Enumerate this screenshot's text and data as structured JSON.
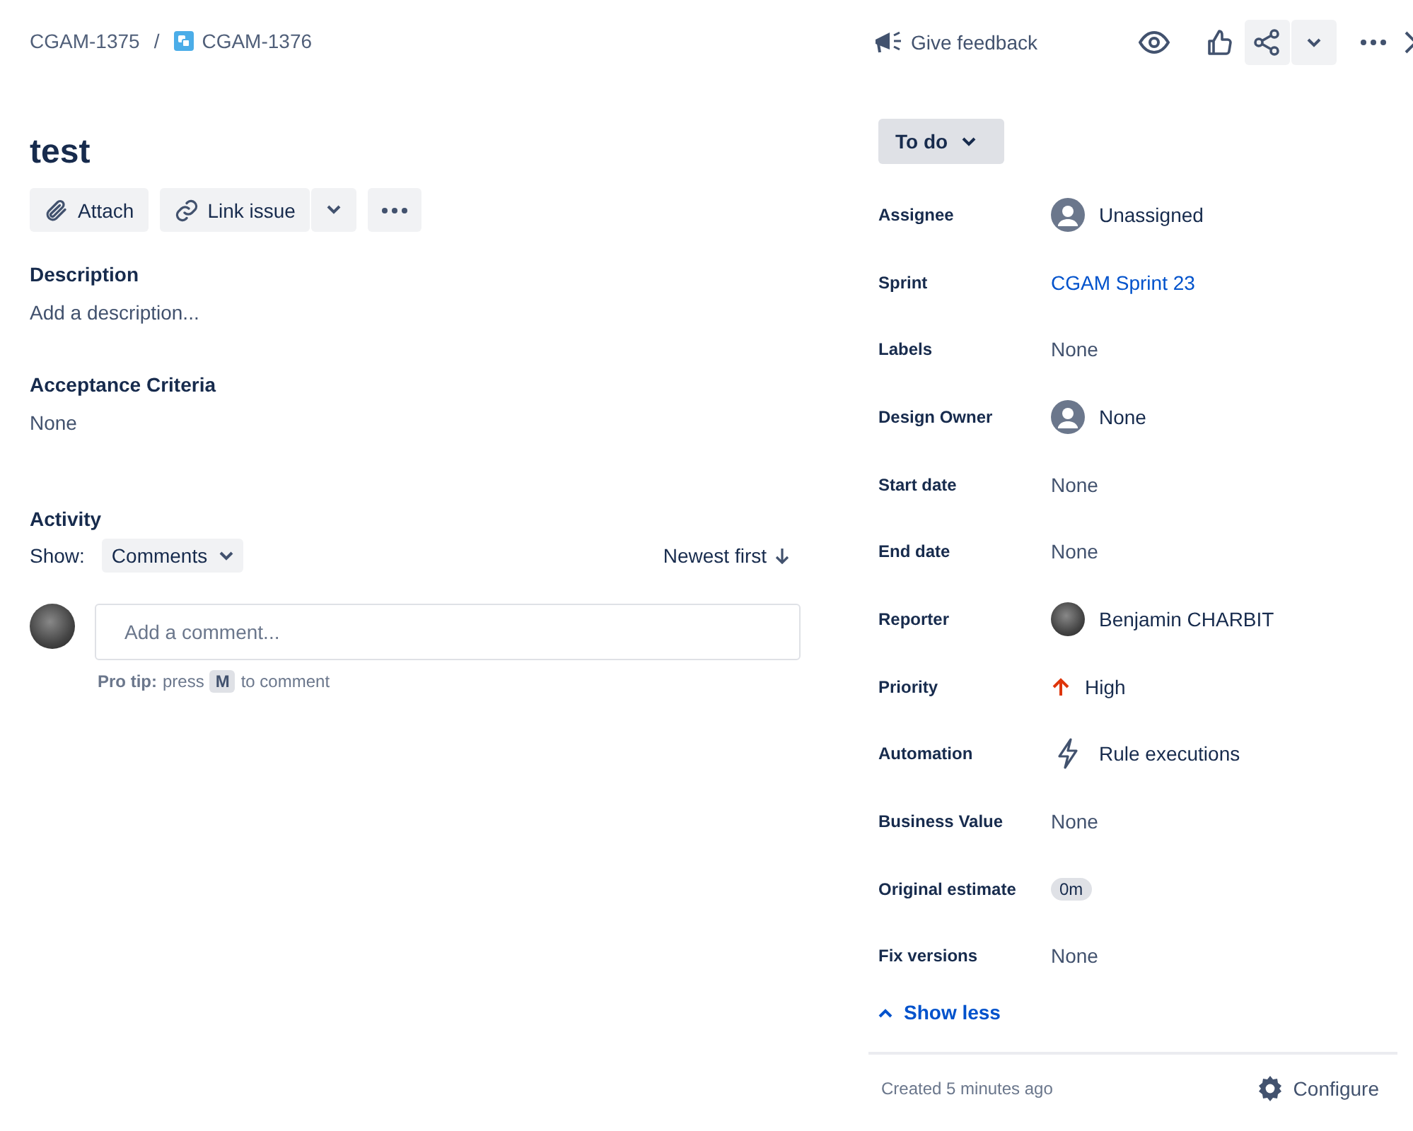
{
  "breadcrumb": {
    "parent": "CGAM-1375",
    "separator": "/",
    "current": "CGAM-1376"
  },
  "title": "test",
  "actions": {
    "attach": "Attach",
    "link": "Link issue"
  },
  "description": {
    "heading": "Description",
    "placeholder": "Add a description..."
  },
  "acceptance": {
    "heading": "Acceptance Criteria",
    "value": "None"
  },
  "activity": {
    "heading": "Activity",
    "show_label": "Show:",
    "filter": "Comments",
    "sort": "Newest first",
    "comment_placeholder": "Add a comment...",
    "tip_bold": "Pro tip:",
    "tip_pre": "press",
    "tip_key": "M",
    "tip_post": "to comment"
  },
  "header": {
    "feedback": "Give feedback"
  },
  "status": "To do",
  "fields": [
    {
      "label": "Assignee",
      "value": "Unassigned",
      "kind": "avatar"
    },
    {
      "label": "Sprint",
      "value": "CGAM Sprint 23",
      "kind": "link"
    },
    {
      "label": "Labels",
      "value": "None",
      "kind": "text"
    },
    {
      "label": "Design Owner",
      "value": "None",
      "kind": "avatar"
    },
    {
      "label": "Start date",
      "value": "None",
      "kind": "text"
    },
    {
      "label": "End date",
      "value": "None",
      "kind": "text"
    },
    {
      "label": "Reporter",
      "value": "Benjamin CHARBIT",
      "kind": "photo"
    },
    {
      "label": "Priority",
      "value": "High",
      "kind": "priority"
    },
    {
      "label": "Automation",
      "value": "Rule executions",
      "kind": "automation"
    },
    {
      "label": "Business Value",
      "value": "None",
      "kind": "text"
    },
    {
      "label": "Original estimate",
      "value": "0m",
      "kind": "badge"
    },
    {
      "label": "Fix versions",
      "value": "None",
      "kind": "text"
    }
  ],
  "show_less": "Show less",
  "footer": {
    "created": "Created 5 minutes ago",
    "configure": "Configure"
  }
}
